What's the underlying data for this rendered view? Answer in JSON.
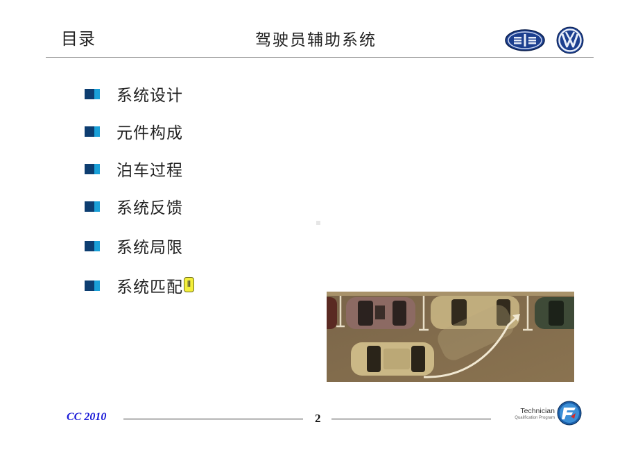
{
  "header": {
    "title": "目录",
    "subject": "驾驶员辅助系统",
    "logos": [
      "faw-logo",
      "vw-logo"
    ]
  },
  "toc": {
    "items": [
      {
        "label": "系统设计"
      },
      {
        "label": "元件构成"
      },
      {
        "label": "泊车过程"
      },
      {
        "label": "系统反馈"
      },
      {
        "label": "系统局限"
      },
      {
        "label": "系统匹配",
        "has_comment_marker": true
      }
    ],
    "comment_marker_glyph": "Ⅱ"
  },
  "image": {
    "description": "top-down view of a car performing parallel parking maneuver between parked cars, with curved arrow path"
  },
  "footer": {
    "left_label": "CC 2010",
    "page_number": "2",
    "program_title": "Technician",
    "program_subtitle": "Qualification Program"
  },
  "colors": {
    "bullet_dark": "#0d3d70",
    "bullet_light": "#1aa0d8",
    "footer_text": "#1a1ad8",
    "comment_marker": "#f4ef3a"
  }
}
